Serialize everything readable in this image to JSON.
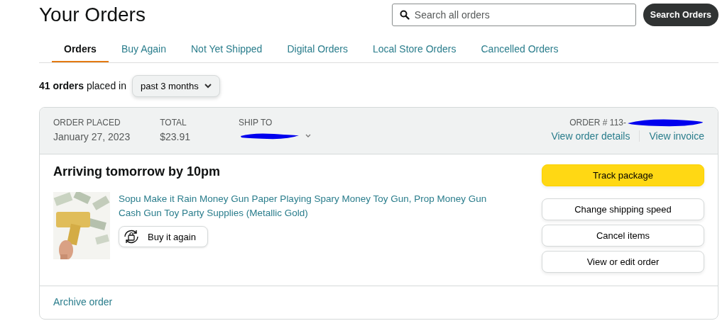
{
  "title": "Your Orders",
  "search": {
    "placeholder": "Search all orders",
    "button": "Search Orders"
  },
  "tabs": [
    {
      "label": "Orders",
      "selected": true
    },
    {
      "label": "Buy Again",
      "selected": false
    },
    {
      "label": "Not Yet Shipped",
      "selected": false
    },
    {
      "label": "Digital Orders",
      "selected": false
    },
    {
      "label": "Local Store Orders",
      "selected": false
    },
    {
      "label": "Cancelled Orders",
      "selected": false
    }
  ],
  "summary": {
    "count": "41 orders",
    "text": "placed in",
    "filter": "past 3 months"
  },
  "order": {
    "placed_label": "ORDER PLACED",
    "placed": "January 27, 2023",
    "total_label": "TOTAL",
    "total": "$23.91",
    "ship_to_label": "SHIP TO",
    "number_label": "ORDER # 113-",
    "details_link": "View order details",
    "invoice_link": "View invoice",
    "status": "Arriving tomorrow by 10pm",
    "item": {
      "kind": "picture",
      "title": "Sopu Make it Rain Money Gun Paper Playing Spary Money Toy Gun, Prop Money Gun Cash Gun Toy Party Supplies (Metallic Gold)",
      "buy_again": "Buy it again"
    },
    "actions": [
      {
        "label": "Track package",
        "kind": "primary"
      },
      {
        "label": "Change shipping speed",
        "kind": "secondary"
      },
      {
        "label": "Cancel items",
        "kind": "secondary"
      },
      {
        "label": "View or edit order",
        "kind": "secondary"
      }
    ],
    "archive": "Archive order"
  }
}
